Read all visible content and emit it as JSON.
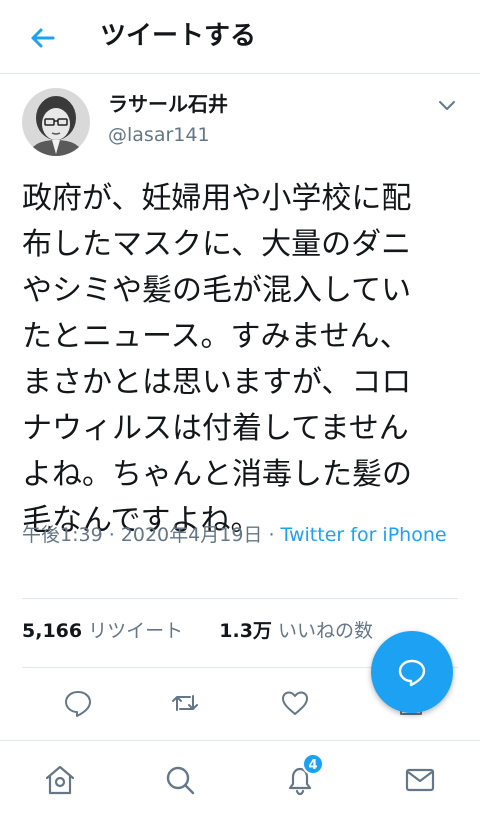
{
  "header": {
    "title": "ツイートする",
    "back_icon": "arrow-left-icon"
  },
  "author": {
    "display_name": "ラサール石井",
    "handle": "@lasar141"
  },
  "tweet": {
    "text": "政府が、妊婦用や小学校に配\n布したマスクに、大量のダニ\nやシミや髪の毛が混入してい\nたとニュース。すみません、\nまさかとは思いますが、コロ\nナウィルスは付着してません\nよね。ちゃんと消毒した髪の\n毛なんですよね。",
    "time": "午後1:39 · 2020年4月19日 · ",
    "source": "Twitter for iPhone"
  },
  "stats": {
    "retweets": "5,166",
    "retweets_label": " リツイート",
    "likes": "1.3万",
    "likes_label": " いいねの数"
  },
  "actions": [
    "reply-icon",
    "retweet-icon",
    "like-icon",
    "share-icon"
  ],
  "nav": {
    "notifications_badge": "4"
  },
  "colors": {
    "accent": "#1da1f2",
    "text": "#14171a",
    "secondary": "#657786",
    "border": "#e1e8ed"
  }
}
